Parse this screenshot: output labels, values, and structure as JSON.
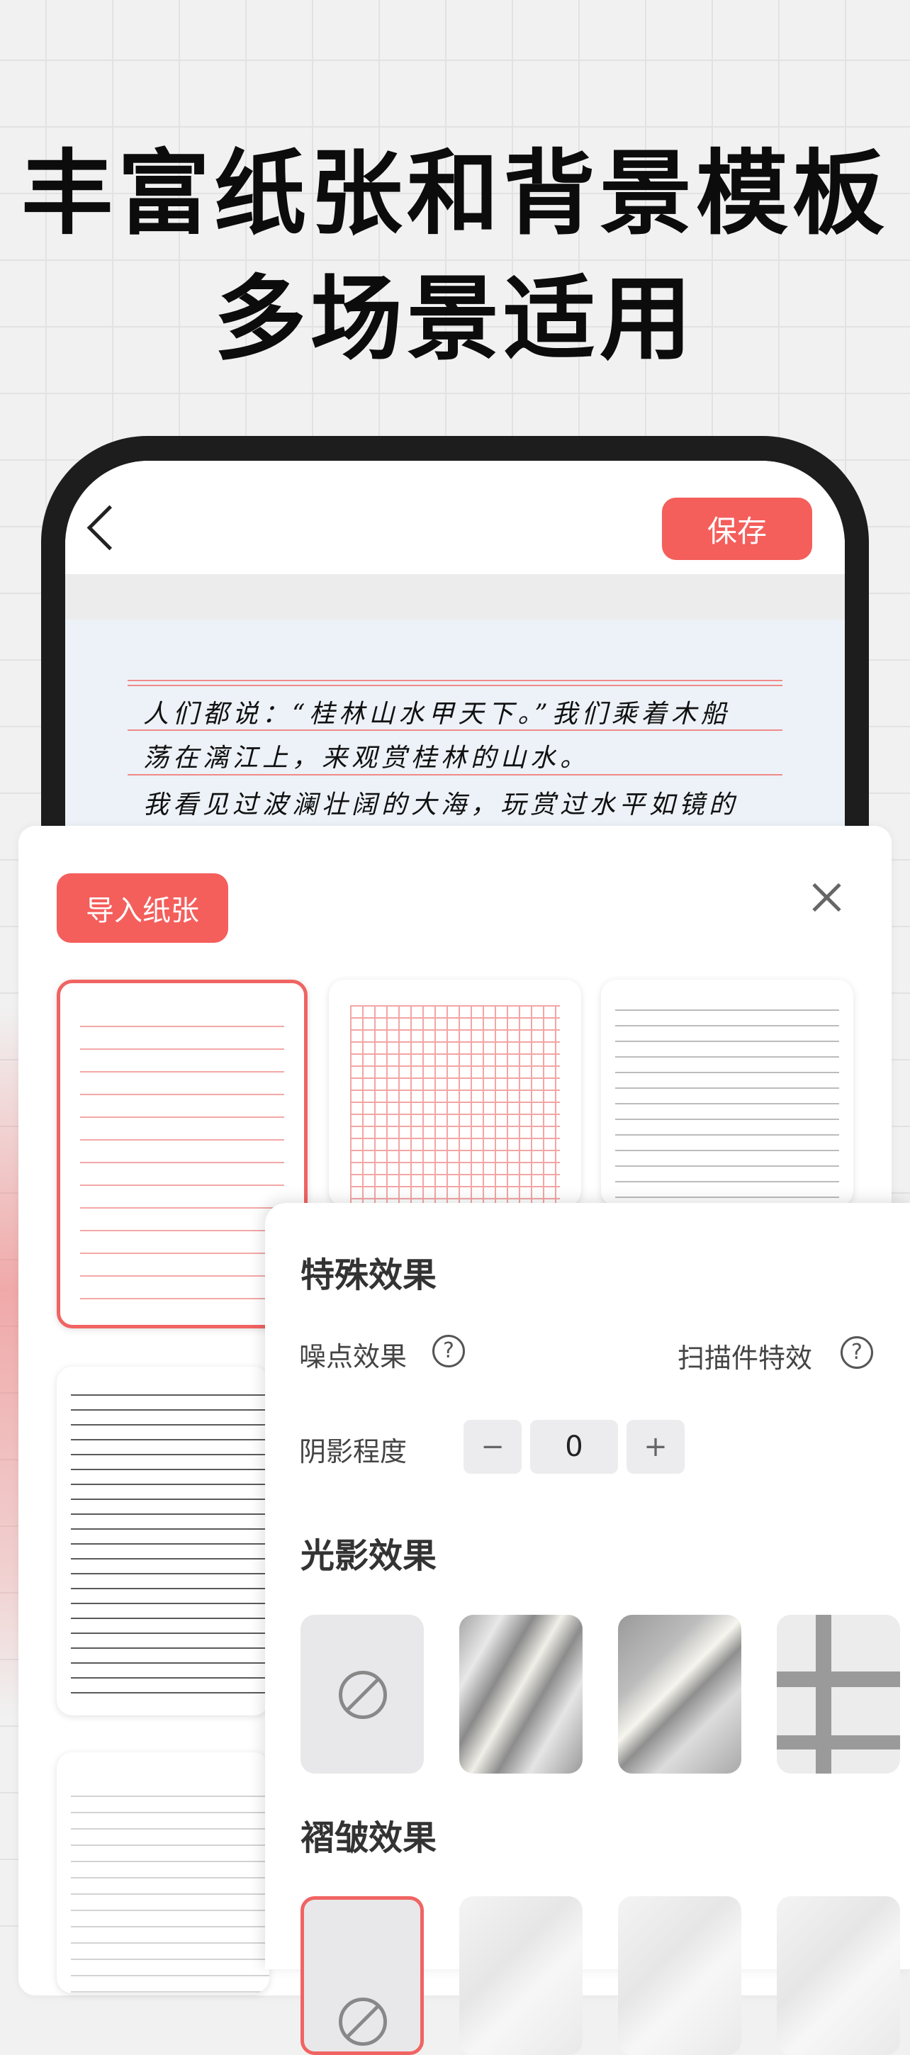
{
  "headline": {
    "line1": "丰富纸张和背景模板",
    "line2": "多场景适用"
  },
  "editor": {
    "save_label": "保存",
    "handwriting": [
      "人们都说：“桂林山水甲天下。”我们乘着木船",
      "荡在漓江上，来观赏桂林的山水。",
      "我看见过波澜壮阔的大海，玩赏过水平如镜的"
    ]
  },
  "sheet": {
    "import_label": "导入纸张",
    "papers": [
      "red-lined",
      "red-grid",
      "gray-dotted-lines",
      "dark-lined",
      "light-lined"
    ]
  },
  "effects": {
    "special_title": "特殊效果",
    "noise_label": "噪点效果",
    "scan_label": "扫描件特效",
    "help_glyph": "?",
    "shadow_label": "阴影程度",
    "shadow_minus": "−",
    "shadow_value": "0",
    "shadow_plus": "+",
    "light_title": "光影效果",
    "wrinkle_title": "褶皱效果"
  },
  "colors": {
    "accent": "#f45e5b",
    "selected_border": "#f06462"
  }
}
